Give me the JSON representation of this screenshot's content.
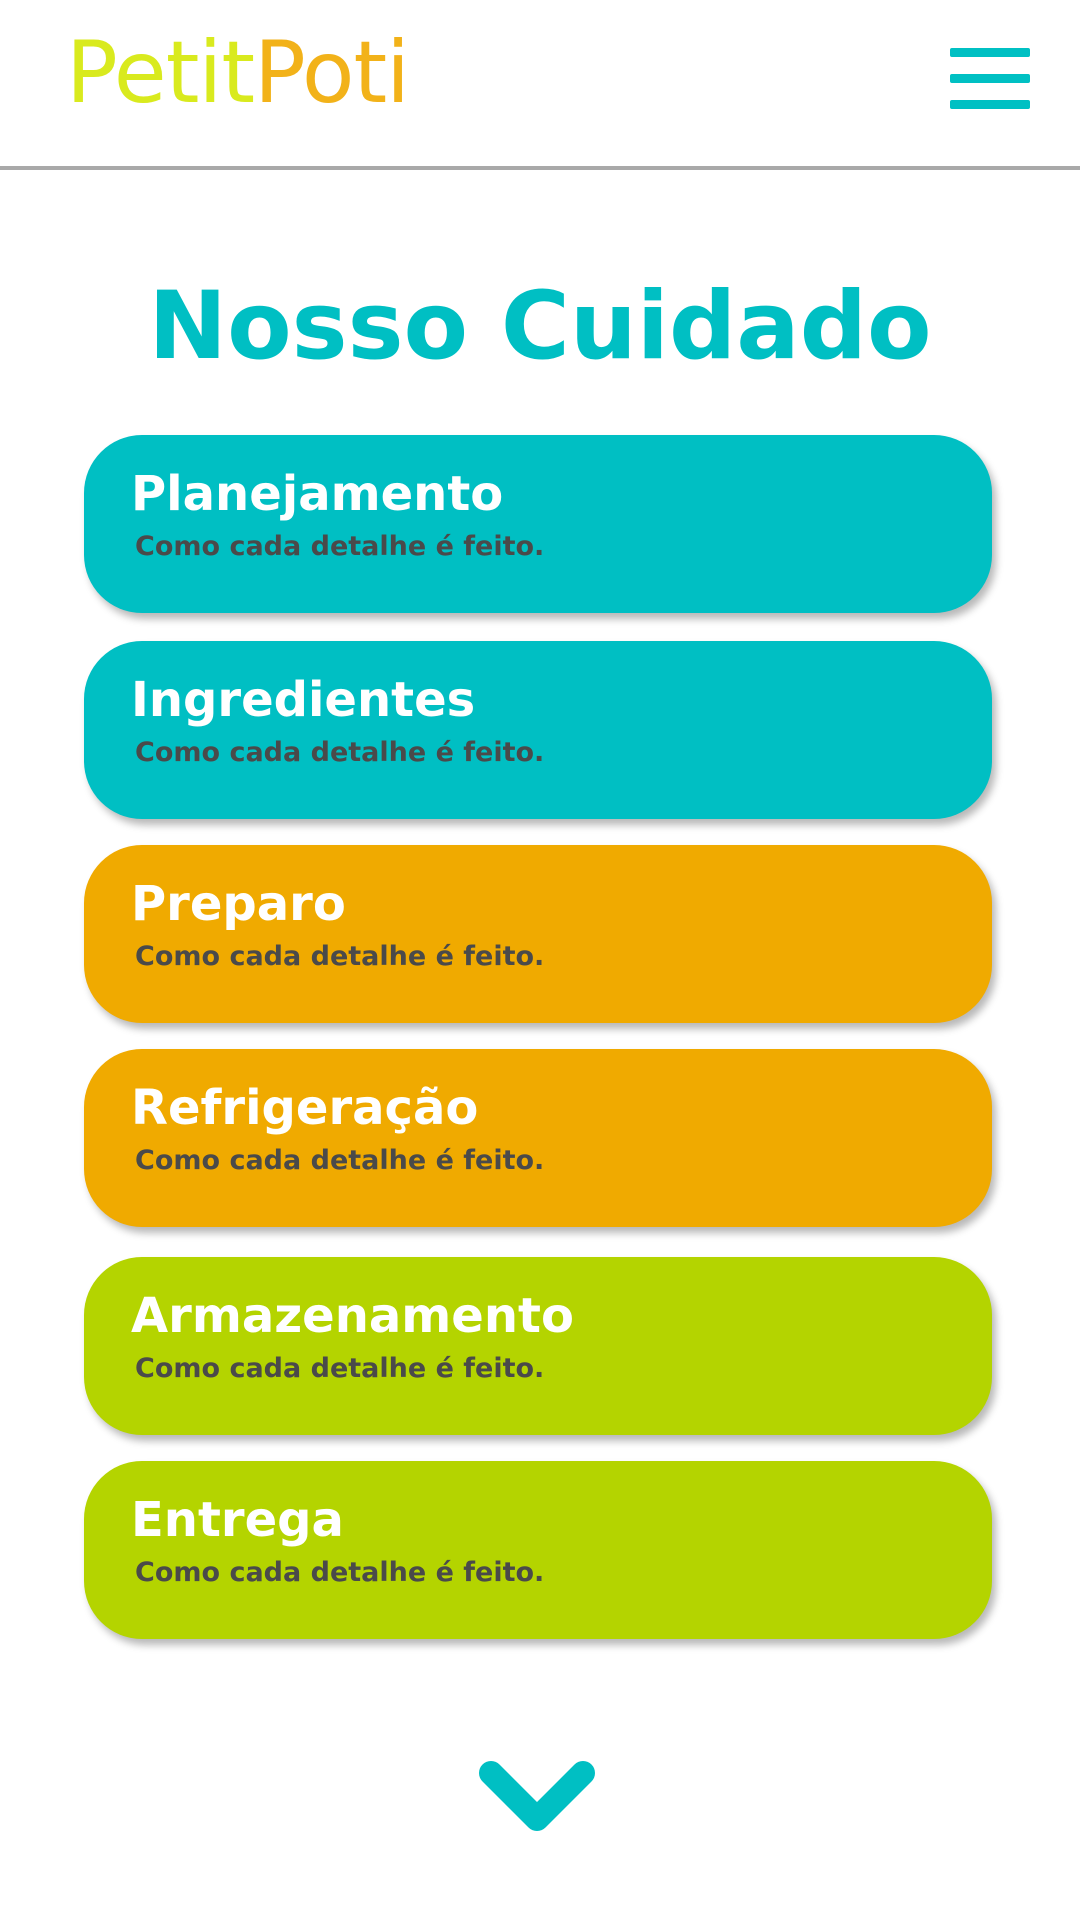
{
  "header": {
    "logo_part1": "Petit",
    "logo_part2": "Poti",
    "menu_icon": "hamburger-menu-icon"
  },
  "main": {
    "title": "Nosso Cuidado",
    "cards": [
      {
        "title": "Planejamento",
        "subtitle": "Como cada detalhe é feito.",
        "color": "#00bfc3"
      },
      {
        "title": "Ingredientes",
        "subtitle": "Como cada detalhe é feito.",
        "color": "#00bfc3"
      },
      {
        "title": "Preparo",
        "subtitle": "Como cada detalhe é feito.",
        "color": "#f0aa00"
      },
      {
        "title": "Refrigeração",
        "subtitle": "Como cada detalhe é feito.",
        "color": "#f0aa00"
      },
      {
        "title": "Armazenamento",
        "subtitle": "Como cada detalhe é feito.",
        "color": "#b4d400"
      },
      {
        "title": "Entrega",
        "subtitle": "Como cada detalhe é feito.",
        "color": "#b4d400"
      }
    ],
    "scroll_icon": "chevron-down-icon"
  },
  "colors": {
    "accent": "#00bfc3",
    "orange": "#f0aa00",
    "lime": "#b4d400",
    "logo_yellow": "#d9ea1e",
    "logo_orange": "#f2b219"
  }
}
